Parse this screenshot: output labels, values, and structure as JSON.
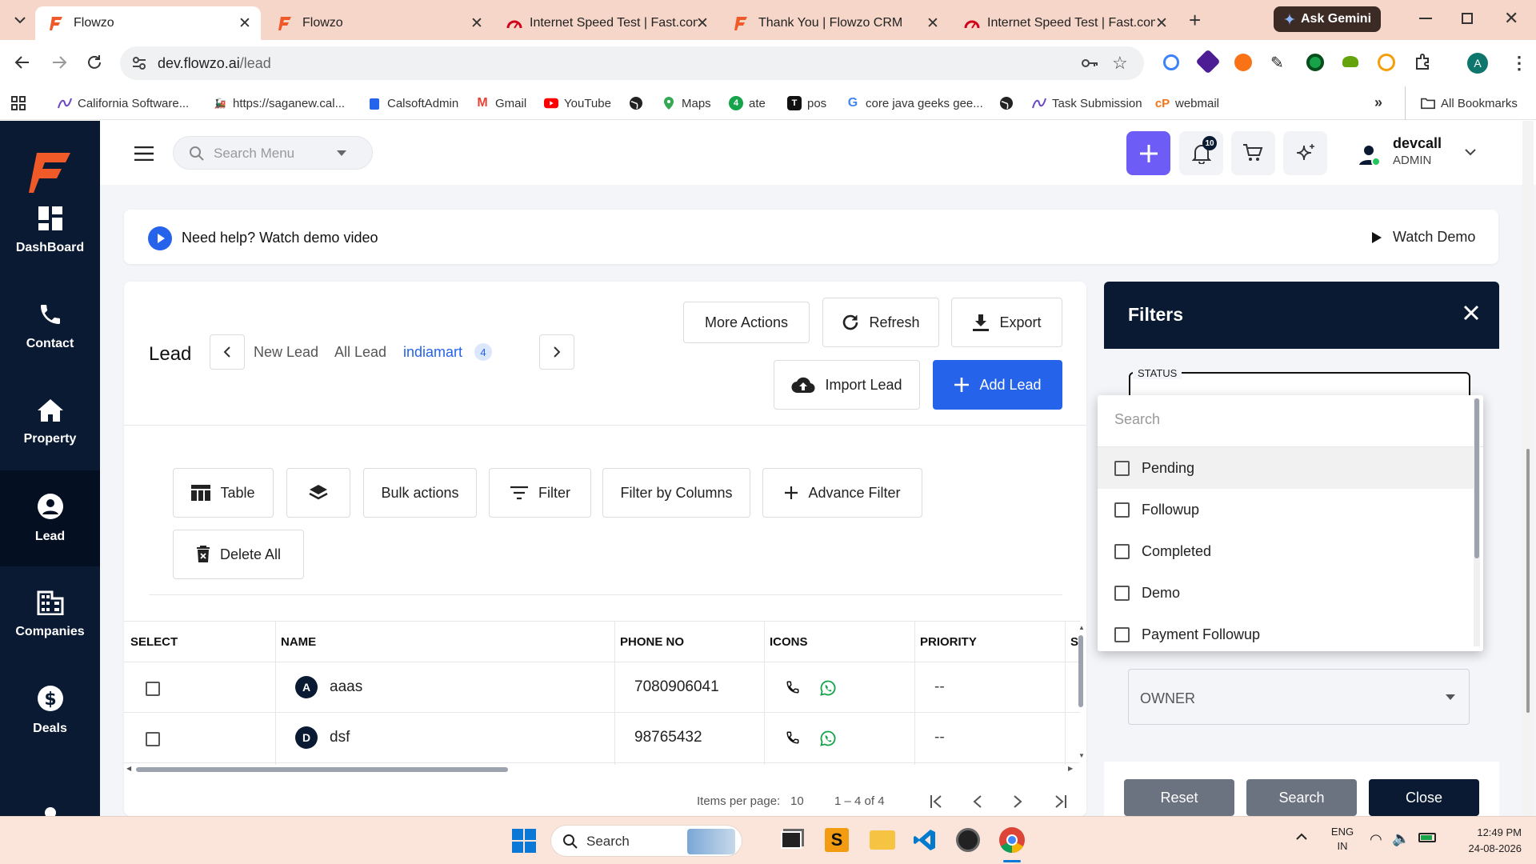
{
  "browser": {
    "tabs": [
      {
        "title": "Flowzo",
        "active": true
      },
      {
        "title": "Flowzo",
        "active": false
      },
      {
        "title": "Internet Speed Test | Fast.com",
        "active": false
      },
      {
        "title": "Thank You | Flowzo CRM",
        "active": false
      },
      {
        "title": "Internet Speed Test | Fast.com",
        "active": false
      }
    ],
    "ask_gemini": "Ask Gemini",
    "url_host": "dev.flowzo.ai",
    "url_path": "/lead",
    "profile_initial": "A",
    "bookmarks": [
      "California Software...",
      "https://saganew.cal...",
      "CalsoftAdmin",
      "Gmail",
      "YouTube",
      "",
      "Maps",
      "ate",
      "pos",
      "core java geeks gee...",
      "",
      "Task Submission",
      "webmail"
    ],
    "all_bookmarks": "All Bookmarks"
  },
  "sidebar": {
    "items": [
      {
        "label": "DashBoard",
        "icon": "dashboard-icon"
      },
      {
        "label": "Contact",
        "icon": "phone-icon"
      },
      {
        "label": "Property",
        "icon": "home-icon"
      },
      {
        "label": "Lead",
        "icon": "user-circle-icon",
        "active": true
      },
      {
        "label": "Companies",
        "icon": "building-icon"
      },
      {
        "label": "Deals",
        "icon": "dollar-icon"
      }
    ]
  },
  "topbar": {
    "search_placeholder": "Search Menu",
    "notification_count": "10",
    "user_name": "devcall",
    "user_role": "ADMIN"
  },
  "help": {
    "text": "Need help? Watch demo video",
    "watch_demo": "Watch Demo"
  },
  "lead": {
    "title": "Lead",
    "tabs": [
      "New Lead",
      "All Lead",
      "indiamart"
    ],
    "active_tab": "indiamart",
    "active_count": "4",
    "more_actions": "More Actions",
    "refresh": "Refresh",
    "export": "Export",
    "import_lead": "Import Lead",
    "add_lead": "Add Lead",
    "toolbar": {
      "table": "Table",
      "bulk_actions": "Bulk actions",
      "filter": "Filter",
      "filter_by_columns": "Filter by Columns",
      "advance_filter": "Advance Filter",
      "delete_all": "Delete All"
    },
    "columns": [
      "SELECT",
      "NAME",
      "PHONE NO",
      "ICONS",
      "PRIORITY",
      "S"
    ],
    "rows": [
      {
        "initial": "A",
        "name": "aaas",
        "phone": "7080906041",
        "priority": "--"
      },
      {
        "initial": "D",
        "name": "dsf",
        "phone": "98765432",
        "priority": "--"
      }
    ],
    "paginator": {
      "items_per_page_label": "Items per page:",
      "items_per_page": "10",
      "range": "1 – 4 of 4"
    }
  },
  "filters": {
    "title": "Filters",
    "status_label": "STATUS",
    "search_placeholder": "Search",
    "options": [
      "Pending",
      "Followup",
      "Completed",
      "Demo",
      "Payment Followup"
    ],
    "owner_label": "OWNER",
    "reset": "Reset",
    "search": "Search",
    "close": "Close"
  },
  "taskbar": {
    "search_placeholder": "Search",
    "lang_line1": "ENG",
    "lang_line2": "IN",
    "time": "12:49 PM",
    "date": "24-08-2026"
  },
  "colors": {
    "navy": "#0a1a33",
    "primary": "#2563eb",
    "accent_purple": "#6d5cf5",
    "tab_strip": "#f6d6c8",
    "muted_button": "#6b7280"
  }
}
